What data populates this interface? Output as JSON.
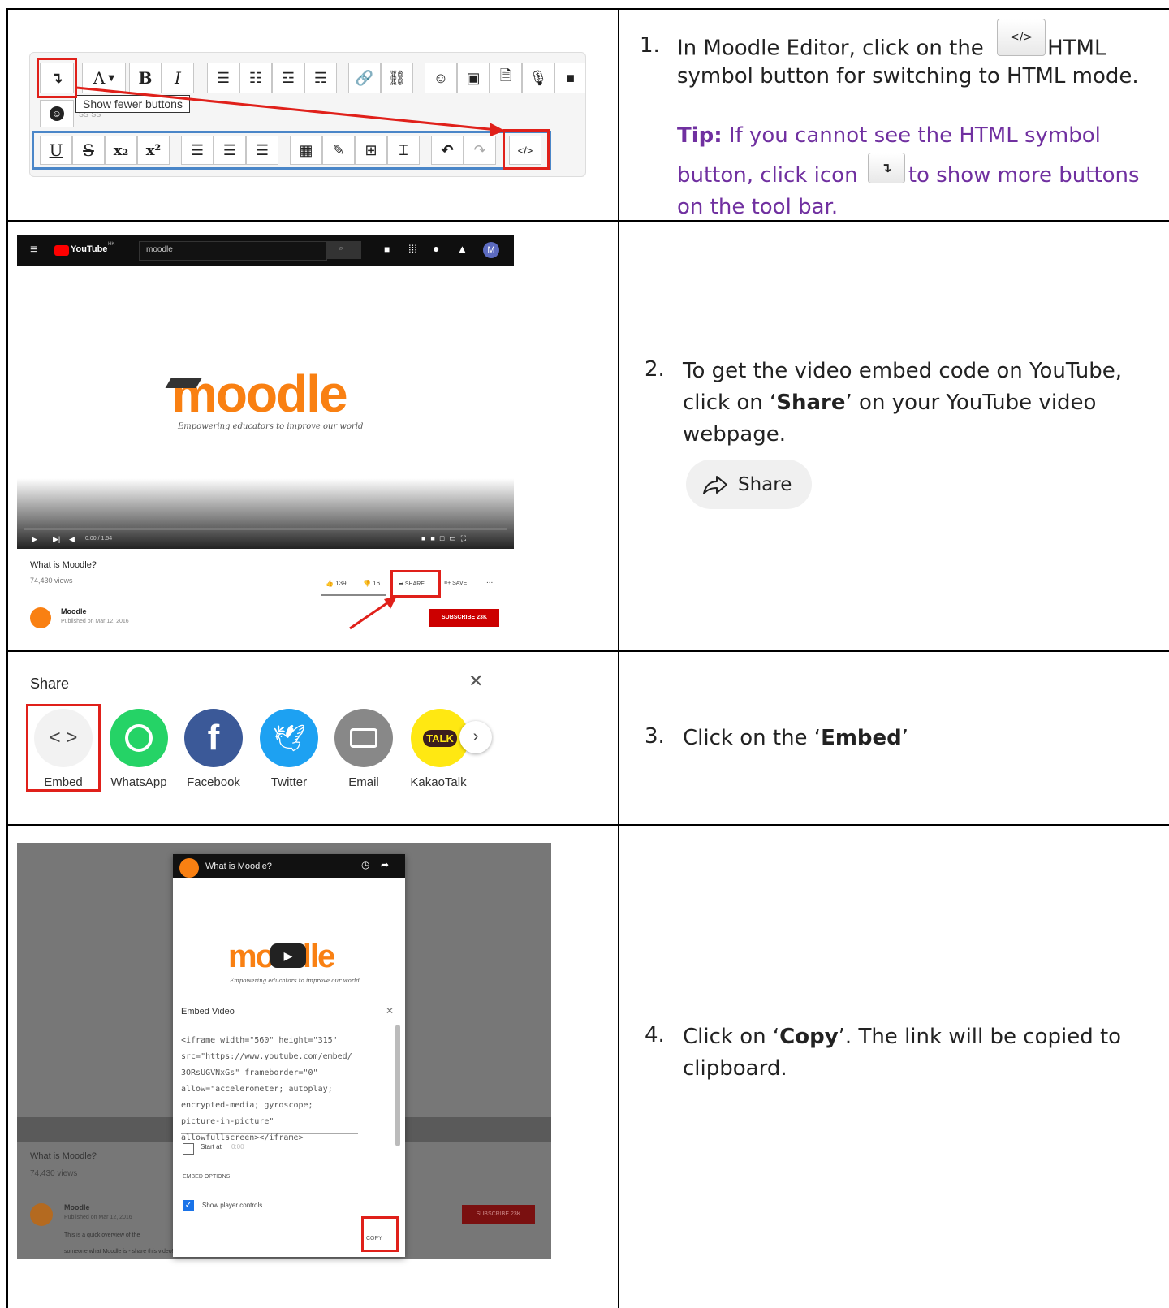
{
  "rows": [
    {
      "number": "1.",
      "text_before_icon": "In Moodle Editor, click on the",
      "text_after_icon": "HTML",
      "text_line2": "symbol button for switching to HTML mode.",
      "tip_label": "Tip:",
      "tip_line1": " If you cannot see the HTML symbol",
      "tip_before_icon": "button, click icon",
      "tip_after_icon": "to show more buttons",
      "tip_line3": "on the tool bar."
    },
    {
      "number": "2.",
      "line1": "To get the video embed code on YouTube,",
      "line2_before": "click on ‘",
      "line2_bold": "Share",
      "line2_after": "’ on your YouTube video",
      "line3": "webpage.",
      "share_button_label": "Share"
    },
    {
      "number": "3.",
      "text_before": "Click on the ‘",
      "bold": "Embed",
      "text_after": "’"
    },
    {
      "number": "4.",
      "text_before": "Click on ‘",
      "bold": "Copy",
      "text_after": "’. The link will be copied to",
      "line2": "clipboard."
    }
  ],
  "editor": {
    "tooltip": "Show fewer buttons",
    "font_btn": "A",
    "bold_btn": "B",
    "italic_btn": "I",
    "underline_btn": "U",
    "strike_btn": "S",
    "sub_btn": "x₂",
    "sup_btn": "x²",
    "html_btn": "</>",
    "toggle_btn": "↴",
    "partial_text": "ss ss"
  },
  "youtube": {
    "logo_text": "YouTube",
    "region": "HK",
    "search_value": "moodle",
    "brand": "moodle",
    "tagline": "Empowering educators to improve our world",
    "time": "0:00 / 1:54",
    "video_title": "What is Moodle?",
    "views": "74,430 views",
    "likes": "139",
    "dislikes": "16",
    "share": "SHARE",
    "save": "SAVE",
    "more": "...",
    "channel": "Moodle",
    "published": "Published on Mar 12, 2016",
    "subscribe": "SUBSCRIBE 23K",
    "avatar": "M"
  },
  "share_dialog": {
    "title": "Share",
    "close": "✕",
    "items": [
      "Embed",
      "WhatsApp",
      "Facebook",
      "Twitter",
      "Email",
      "KakaoTalk"
    ],
    "talk": "TALK",
    "embed_glyph": "< >"
  },
  "embed_dialog": {
    "video_title": "What is Moodle?",
    "heading": "Embed Video",
    "close": "✕",
    "code_lines": [
      "<iframe width=\"560\" height=\"315\"",
      "src=\"https://www.youtube.com/embed/",
      "3ORsUGVNxGs\" frameborder=\"0\"",
      "allow=\"accelerometer; autoplay;",
      "encrypted-media; gyroscope;",
      "picture-in-picture\"",
      "allowfullscreen></iframe>"
    ],
    "start_at": "Start at",
    "start_time": "0:00",
    "options_heading": "EMBED OPTIONS",
    "show_controls": "Show player controls",
    "copy": "COPY",
    "bg_title": "What is Moodle?",
    "bg_views": "74,430 views",
    "bg_channel": "Moodle",
    "bg_published": "Published on Mar 12, 2016",
    "bg_subscribe": "SUBSCRIBE 23K",
    "bg_desc1": "This is a quick overview of the",
    "bg_desc2": "someone what Moodle is - share this video!"
  },
  "colors": {
    "tip": "#7030a0",
    "red": "#e0201a",
    "blue_box": "#4a86c8",
    "whatsapp": "#25d366",
    "facebook": "#3b5998",
    "twitter": "#1da1f2",
    "email": "#888888",
    "kakao": "#ffe812",
    "moodle_orange": "#f98012"
  }
}
